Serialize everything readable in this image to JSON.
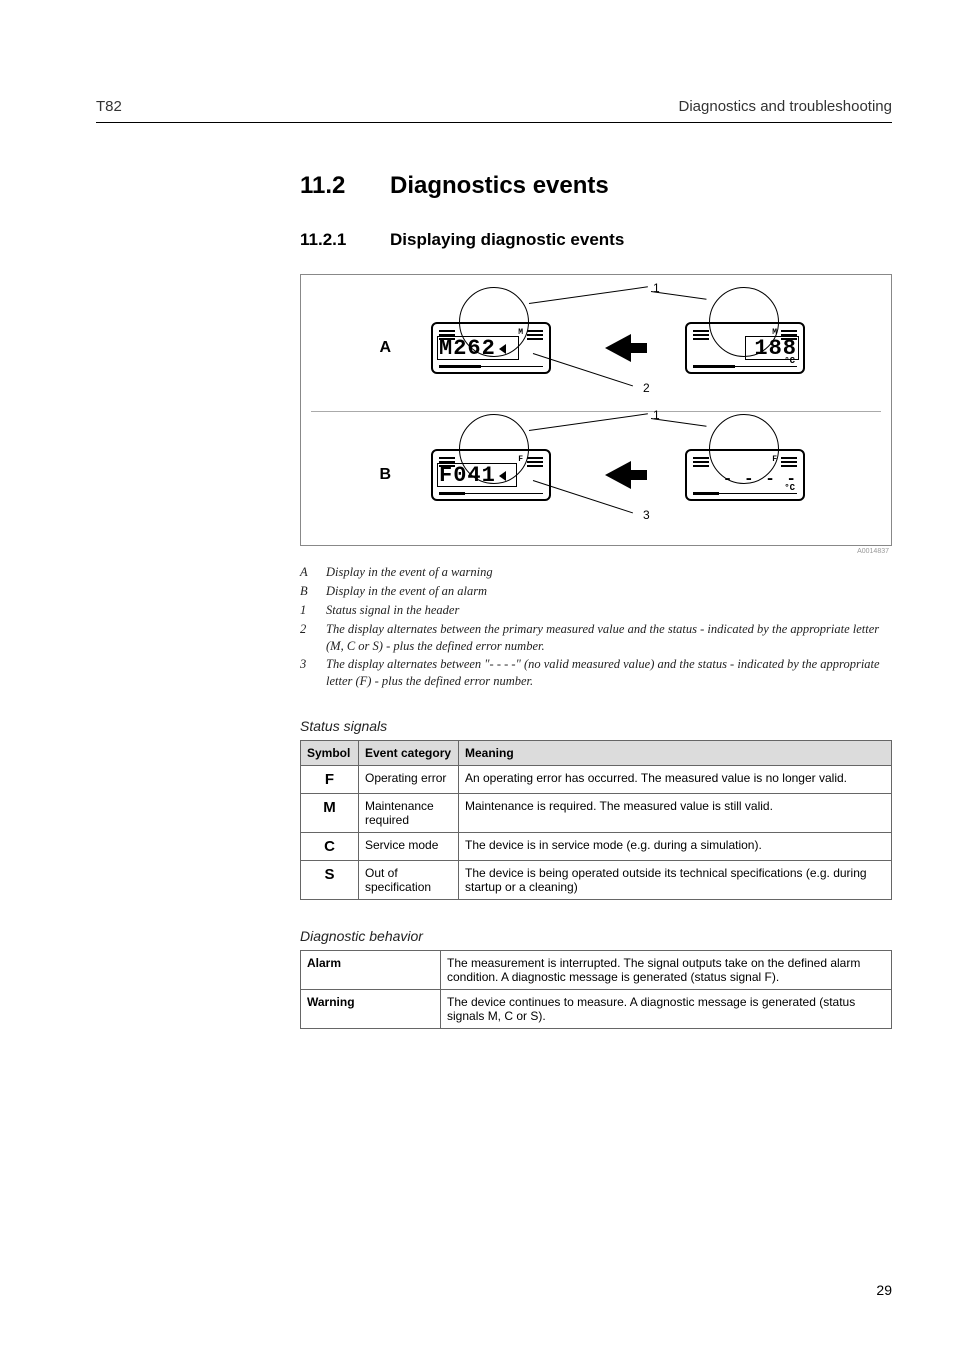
{
  "header": {
    "left": "T82",
    "right": "Diagnostics and troubleshooting"
  },
  "section": {
    "num": "11.2",
    "title": "Diagnostics events"
  },
  "subsection": {
    "num": "11.2.1",
    "title": "Displaying diagnostic events"
  },
  "figure": {
    "id": "A0014837",
    "row_a_label": "A",
    "row_b_label": "B",
    "lcd_a_left": {
      "text": "M262",
      "flag": "M"
    },
    "lcd_a_right": {
      "text": "188",
      "unit": "°C",
      "flag": "M"
    },
    "lcd_b_left": {
      "text": "F041",
      "flag": "F"
    },
    "lcd_b_right": {
      "text": "- - - -",
      "unit": "°C",
      "flag": "F"
    },
    "callouts": {
      "c1": "1",
      "c2": "2",
      "c3": "3"
    }
  },
  "caption": [
    {
      "k": "A",
      "v": "Display in the event of a warning"
    },
    {
      "k": "B",
      "v": "Display in the event of an alarm"
    },
    {
      "k": "1",
      "v": "Status signal in the header"
    },
    {
      "k": "2",
      "v": "The display alternates between the primary measured value and the status - indicated by the appropriate letter (M, C or S) - plus the defined error number."
    },
    {
      "k": "3",
      "v": "The display alternates between \"- - - -\" (no valid measured value) and the status - indicated by the appropriate letter (F) - plus the defined error number."
    }
  ],
  "status_signals": {
    "title": "Status signals",
    "headers": [
      "Symbol",
      "Event category",
      "Meaning"
    ],
    "rows": [
      {
        "symbol": "F",
        "cat": "Operating error",
        "meaning": "An operating error has occurred. The measured value is no longer valid."
      },
      {
        "symbol": "M",
        "cat": "Maintenance required",
        "meaning": "Maintenance is required. The measured value is still valid."
      },
      {
        "symbol": "C",
        "cat": "Service mode",
        "meaning": "The device is in service mode (e.g. during a simulation)."
      },
      {
        "symbol": "S",
        "cat": "Out of specification",
        "meaning": "The device is being operated outside its technical specifications (e.g. during startup or a cleaning)"
      }
    ]
  },
  "diag_behavior": {
    "title": "Diagnostic behavior",
    "rows": [
      {
        "k": "Alarm",
        "v": "The measurement is interrupted. The signal outputs take on the defined alarm condition. A diagnostic message is generated (status signal F)."
      },
      {
        "k": "Warning",
        "v": "The device continues to measure. A diagnostic message is generated (status signals M, C or S)."
      }
    ]
  },
  "page_number": "29"
}
